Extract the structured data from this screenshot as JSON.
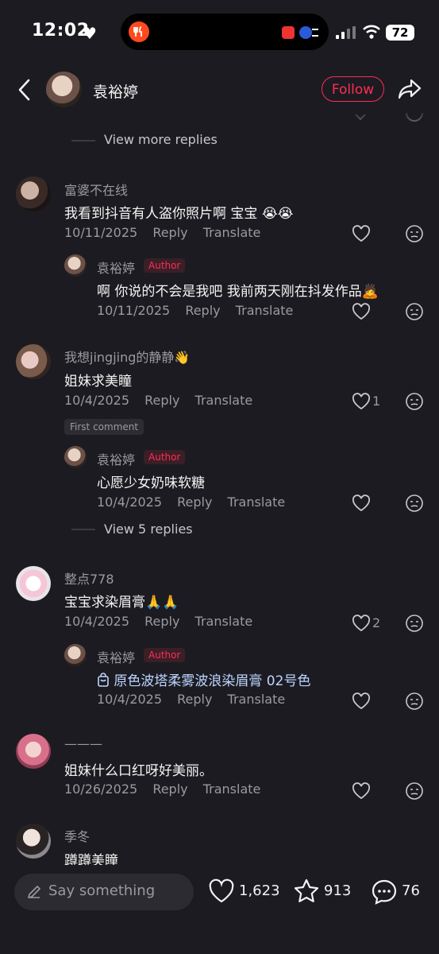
{
  "status": {
    "time": "12:02",
    "battery": "72"
  },
  "header": {
    "name": "袁裕婷",
    "follow": "Follow"
  },
  "top_thread": {
    "view_more": "View more replies"
  },
  "comments": [
    {
      "user": "富婆不在线",
      "text": "我看到抖音有人盗你照片啊 宝宝",
      "emoji": "😭😭",
      "date": "10/11/2025",
      "reply": "Reply",
      "translate": "Translate",
      "likes": "",
      "reply_item": {
        "user": "袁裕婷",
        "tag": "Author",
        "text": "啊 你说的不会是我吧 我前两天刚在抖发作品",
        "emoji": "🙇",
        "date": "10/11/2025",
        "reply": "Reply",
        "translate": "Translate"
      }
    },
    {
      "user": "我想jingjing的静静",
      "user_emoji": "👋",
      "text": "姐妹求美瞳",
      "date": "10/4/2025",
      "reply": "Reply",
      "translate": "Translate",
      "likes": "1",
      "first_tag": "First comment",
      "reply_item": {
        "user": "袁裕婷",
        "tag": "Author",
        "text": "心愿少女奶味软糖",
        "date": "10/4/2025",
        "reply": "Reply",
        "translate": "Translate"
      },
      "view_replies": "View 5 replies"
    },
    {
      "user": "整点778",
      "text": "宝宝求染眉膏",
      "emoji": "🙏🙏",
      "date": "10/4/2025",
      "reply": "Reply",
      "translate": "Translate",
      "likes": "2",
      "reply_item": {
        "user": "袁裕婷",
        "tag": "Author",
        "text": "原色波塔柔雾波浪染眉膏 02号色",
        "date": "10/4/2025",
        "reply": "Reply",
        "translate": "Translate"
      }
    },
    {
      "user": "———",
      "text": "姐妹什么口红呀好美丽。",
      "date": "10/26/2025",
      "reply": "Reply",
      "translate": "Translate",
      "likes": ""
    },
    {
      "user": "季冬",
      "text": "蹲蹲美瞳"
    }
  ],
  "bottom": {
    "placeholder": "Say something",
    "likes": "1,623",
    "favorites": "913",
    "comments": "76"
  },
  "colors": {
    "background": "#1c1b21",
    "accent": "#fe2c55",
    "muted": "#9a9aa0"
  }
}
